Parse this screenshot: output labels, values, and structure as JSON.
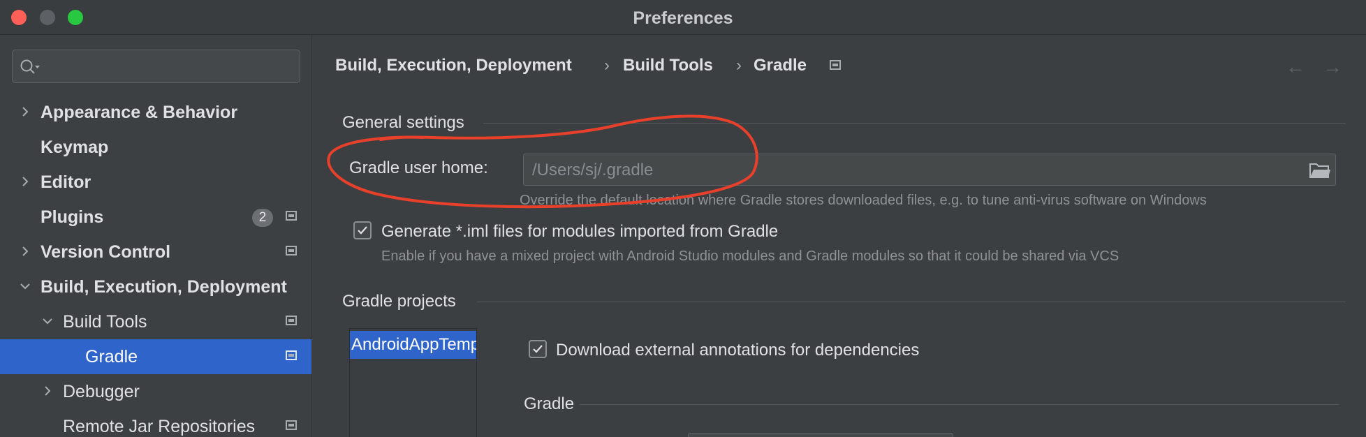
{
  "window": {
    "title": "Preferences"
  },
  "search": {
    "placeholder": "",
    "value": ""
  },
  "sidebar": {
    "items": [
      {
        "label": "Appearance & Behavior"
      },
      {
        "label": "Keymap"
      },
      {
        "label": "Editor"
      },
      {
        "label": "Plugins",
        "badge": "2"
      },
      {
        "label": "Version Control"
      },
      {
        "label": "Build, Execution, Deployment"
      },
      {
        "label": "Build Tools"
      },
      {
        "label": "Gradle"
      },
      {
        "label": "Debugger"
      },
      {
        "label": "Remote Jar Repositories"
      }
    ]
  },
  "breadcrumb": {
    "items": [
      "Build, Execution, Deployment",
      "Build Tools",
      "Gradle"
    ],
    "separator": "›"
  },
  "nav": {
    "back": "←",
    "forward": "→"
  },
  "general": {
    "title": "General settings",
    "gradle_user_home_label": "Gradle user home:",
    "gradle_user_home_placeholder": "/Users/sj/.gradle",
    "gradle_user_home_hint": "Override the default location where Gradle stores downloaded files, e.g. to tune anti-virus software on Windows",
    "iml_label": "Generate *.iml files for modules imported from Gradle",
    "iml_checked": true,
    "iml_hint": "Enable if you have a mixed project with Android Studio modules and Gradle modules so that it could be shared via VCS"
  },
  "projects": {
    "title": "Gradle projects",
    "list": [
      "AndroidAppTemplate"
    ],
    "download_annotations_label": "Download external annotations for dependencies",
    "download_annotations_checked": true,
    "gradle_subsection_title": "Gradle"
  },
  "colors": {
    "selection": "#2f65ca",
    "annotation": "#e8402b",
    "close": "#fe5f57",
    "maximize": "#28c840"
  },
  "icons": [
    "search-icon",
    "chevron-right-icon",
    "chevron-down-icon",
    "project-scope-icon",
    "folder-icon",
    "checkmark-icon",
    "back-arrow-icon",
    "forward-arrow-icon"
  ]
}
